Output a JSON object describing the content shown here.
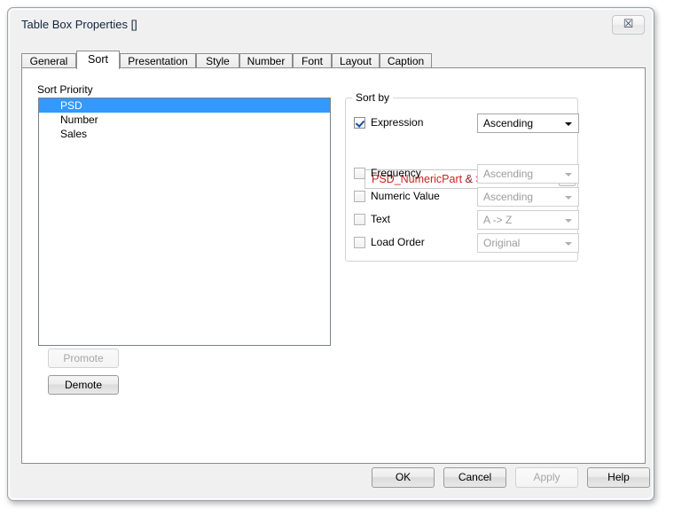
{
  "window": {
    "title": "Table Box Properties []",
    "close_icon": "close-icon",
    "close_glyph": "☒"
  },
  "tabs": [
    {
      "label": "General",
      "active": false
    },
    {
      "label": "Sort",
      "active": true
    },
    {
      "label": "Presentation",
      "active": false
    },
    {
      "label": "Style",
      "active": false
    },
    {
      "label": "Number",
      "active": false
    },
    {
      "label": "Font",
      "active": false
    },
    {
      "label": "Layout",
      "active": false
    },
    {
      "label": "Caption",
      "active": false
    }
  ],
  "sort_priority": {
    "label": "Sort Priority",
    "items": [
      {
        "label": "PSD",
        "selected": true
      },
      {
        "label": "Number",
        "selected": false
      },
      {
        "label": "Sales",
        "selected": false
      }
    ]
  },
  "priority_buttons": {
    "promote": {
      "label": "Promote",
      "enabled": false
    },
    "demote": {
      "label": "Demote",
      "enabled": true
    }
  },
  "sort_by": {
    "legend": "Sort by",
    "expression": {
      "label": "Expression",
      "checked": true,
      "direction": "Ascending",
      "value_prefix": "PSD_NumericPart ",
      "value_amp": "&",
      "value_suffix": " SortOrder",
      "full_value": "PSD_NumericPart & SortOrder",
      "ellipsis_label": "•••",
      "text_color": "#cc2222"
    },
    "options": [
      {
        "label": "Frequency",
        "checked": false,
        "enabled": false,
        "direction": "Ascending"
      },
      {
        "label": "Numeric Value",
        "checked": false,
        "enabled": false,
        "direction": "Ascending"
      },
      {
        "label": "Text",
        "checked": false,
        "enabled": false,
        "direction": "A -> Z"
      },
      {
        "label": "Load Order",
        "checked": false,
        "enabled": false,
        "direction": "Original"
      }
    ]
  },
  "footer": {
    "ok": {
      "label": "OK",
      "enabled": true
    },
    "cancel": {
      "label": "Cancel",
      "enabled": true
    },
    "apply": {
      "label": "Apply",
      "enabled": false
    },
    "help": {
      "label": "Help",
      "enabled": true
    }
  },
  "colors": {
    "selection": "#3399ff",
    "expression_text": "#cc2222",
    "title_text": "#10253f"
  }
}
